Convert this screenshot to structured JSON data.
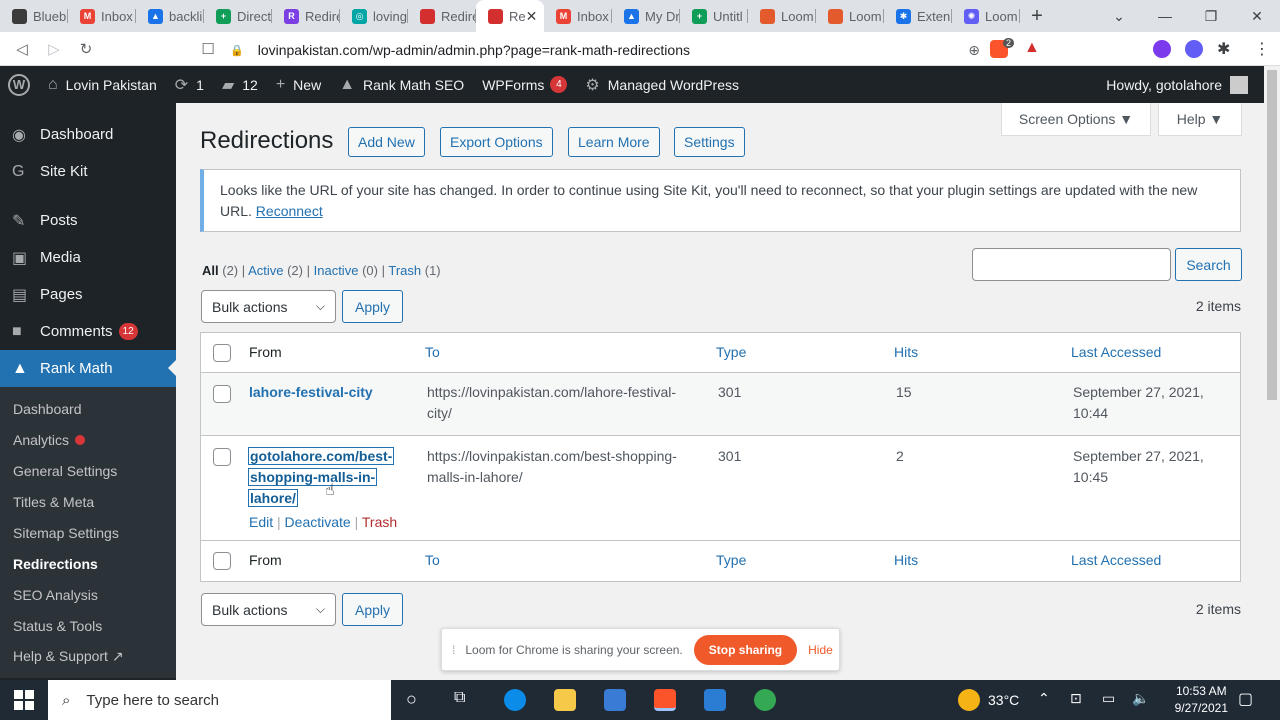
{
  "tabs": [
    {
      "title": "Blueb",
      "color": "#3b3b3b",
      "glyph": ""
    },
    {
      "title": "Inbox",
      "color": "#ea4335",
      "glyph": "M"
    },
    {
      "title": "backli",
      "color": "#1a73e8",
      "glyph": "▲"
    },
    {
      "title": "Direct",
      "color": "#0f9d58",
      "glyph": "+"
    },
    {
      "title": "Redire",
      "color": "#7b3fe4",
      "glyph": "R"
    },
    {
      "title": "loving",
      "color": "#00a5a5",
      "glyph": "◎"
    },
    {
      "title": "Redire",
      "color": "#d32f2f",
      "glyph": ""
    },
    {
      "title": "Re",
      "color": "#d32f2f",
      "glyph": "",
      "active": true
    },
    {
      "title": "Inbox",
      "color": "#ea4335",
      "glyph": "M"
    },
    {
      "title": "My Dr",
      "color": "#1a73e8",
      "glyph": "▲"
    },
    {
      "title": "Untitl",
      "color": "#0f9d58",
      "glyph": "+"
    },
    {
      "title": "Loom",
      "color": "#e35b2c",
      "glyph": ""
    },
    {
      "title": "Loom",
      "color": "#e35b2c",
      "glyph": ""
    },
    {
      "title": "Exten",
      "color": "#1a73e8",
      "glyph": "✱"
    },
    {
      "title": "Loom",
      "color": "#625df5",
      "glyph": "✺"
    }
  ],
  "browser": {
    "url": "lovinpakistan.com/wp-admin/admin.php?page=rank-math-redirections",
    "new_tab": "+",
    "tab_close": "✕",
    "brave_badge": "2"
  },
  "adminbar": {
    "site": "Lovin Pakistan",
    "updates": "1",
    "comments": "12",
    "new": "New",
    "rankmath": "Rank Math SEO",
    "wpforms": "WPForms",
    "wpforms_badge": "4",
    "managed": "Managed WordPress",
    "howdy": "Howdy, gotolahore"
  },
  "sidebar": {
    "menu": [
      {
        "label": "Dashboard",
        "icon": "◉"
      },
      {
        "label": "Site Kit",
        "icon": "G"
      },
      {
        "label": "Posts",
        "icon": "✎"
      },
      {
        "label": "Media",
        "icon": "▣"
      },
      {
        "label": "Pages",
        "icon": "▤"
      },
      {
        "label": "Comments",
        "icon": "■",
        "badge": "12"
      },
      {
        "label": "Rank Math",
        "icon": "▲"
      }
    ],
    "submenu": [
      "Dashboard",
      "Analytics",
      "General Settings",
      "Titles & Meta",
      "Sitemap Settings",
      "Redirections",
      "SEO Analysis",
      "Status & Tools",
      "Help & Support ↗"
    ]
  },
  "page": {
    "screen_options": "Screen Options ▼",
    "help": "Help ▼",
    "title": "Redirections",
    "buttons": [
      "Add New",
      "Export Options",
      "Learn More",
      "Settings"
    ],
    "notice_text": "Looks like the URL of your site has changed. In order to continue using Site Kit, you'll need to reconnect, so that your plugin settings are updated with the new URL.",
    "notice_link": "Reconnect",
    "views": {
      "all": "All",
      "all_count": "(2)",
      "active": "Active",
      "active_count": "(2)",
      "inactive": "Inactive",
      "inactive_count": "(0)",
      "trash": "Trash",
      "trash_count": "(1)",
      "sep": "|"
    },
    "search_button": "Search",
    "bulk_actions": "Bulk actions",
    "apply": "Apply",
    "items": "2 items"
  },
  "table": {
    "headers": {
      "from": "From",
      "to": "To",
      "type": "Type",
      "hits": "Hits",
      "last": "Last Accessed"
    },
    "rows": [
      {
        "from": "lahore-festival-city",
        "to_1": "https://lovinpakistan.com/lahore-festival-",
        "to_2": "city/",
        "type": "301",
        "hits": "15",
        "last_1": "September 27, 2021,",
        "last_2": "10:44"
      },
      {
        "from_1": "gotolahore.com/best-",
        "from_2": "shopping-malls-in-",
        "from_3": "lahore/",
        "to_1": "https://lovinpakistan.com/best-shopping-",
        "to_2": "malls-in-lahore/",
        "type": "301",
        "hits": "2",
        "last_1": "September 27, 2021,",
        "last_2": "10:45",
        "edit": "Edit",
        "deactivate": "Deactivate",
        "trash": "Trash",
        "sep": "|"
      }
    ]
  },
  "loom": {
    "text": "Loom for Chrome is sharing your screen.",
    "stop": "Stop sharing",
    "hide": "Hide"
  },
  "taskbar": {
    "search": "Type here to search",
    "temp": "33°C",
    "time": "10:53 AM",
    "date": "9/27/2021"
  }
}
